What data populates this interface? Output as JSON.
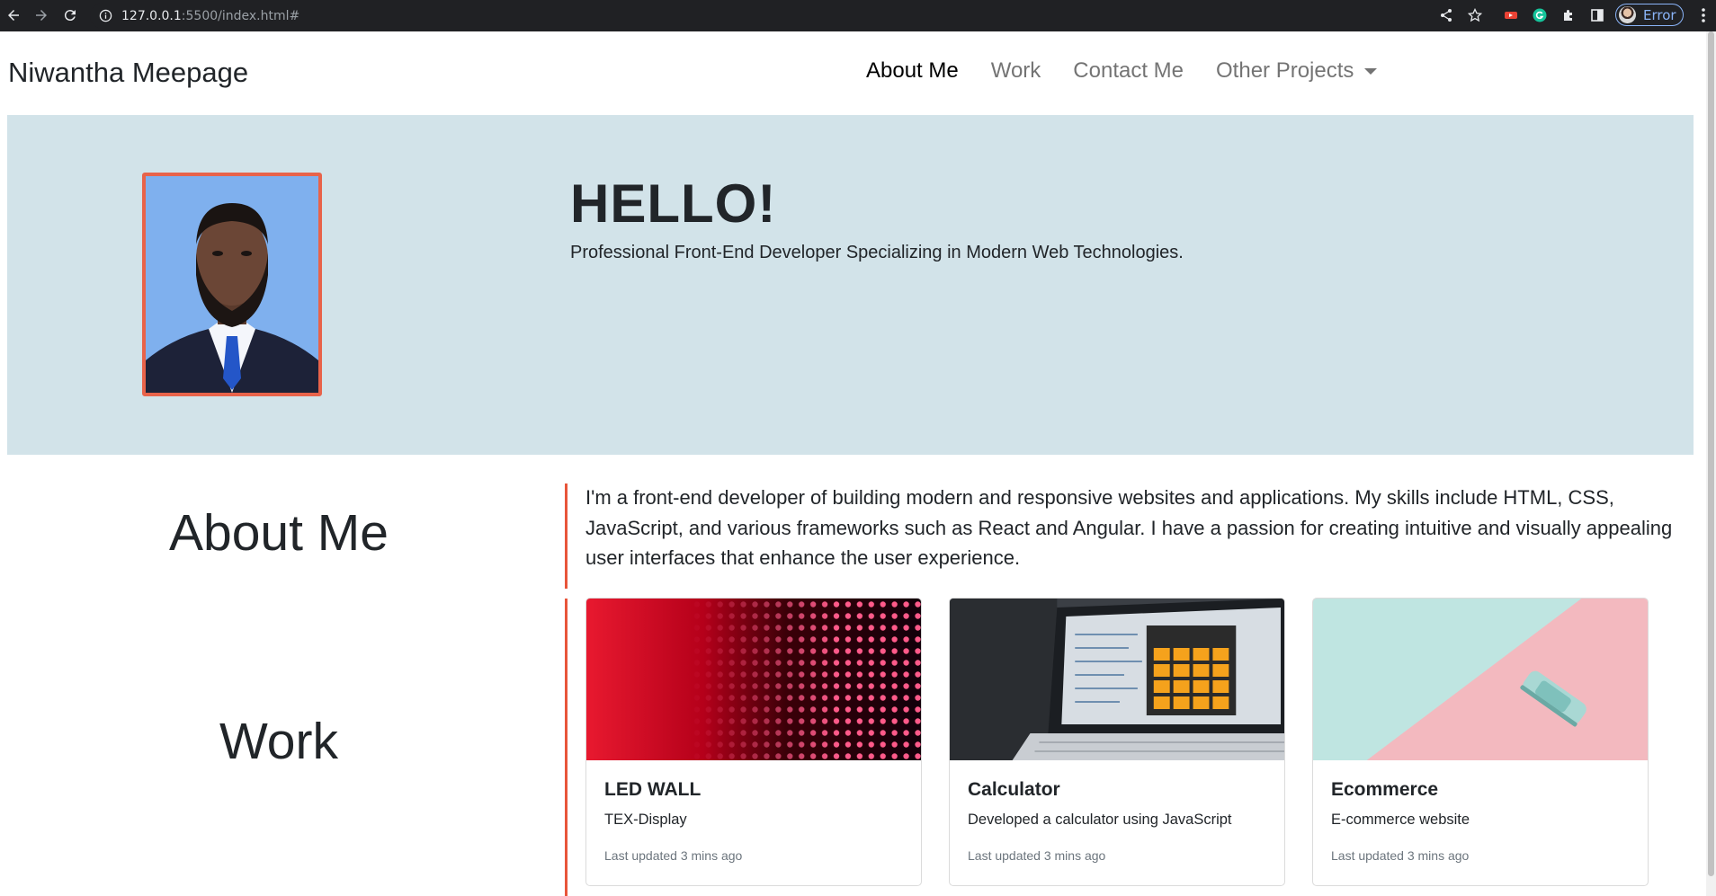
{
  "browser": {
    "url_host": "127.0.0.1",
    "url_rest": ":5500/index.html#",
    "profile_label": "Error",
    "icons": [
      "back-arrow-icon",
      "forward-arrow-icon",
      "reload-icon",
      "site-info-icon",
      "share-icon",
      "bookmark-star-icon",
      "extension-red-icon",
      "grammarly-icon",
      "puzzle-extensions-icon",
      "side-panel-icon",
      "avatar",
      "more-menu-icon"
    ]
  },
  "navbar": {
    "brand": "Niwantha Meepage",
    "links": [
      {
        "label": "About Me",
        "active": true
      },
      {
        "label": "Work",
        "active": false
      },
      {
        "label": "Contact Me",
        "active": false
      },
      {
        "label": "Other Projects",
        "active": false,
        "dropdown": true
      }
    ]
  },
  "hero": {
    "title": "HELLO!",
    "subtitle": "Professional Front-End Developer Specializing in Modern Web Technologies."
  },
  "about": {
    "heading": "About Me",
    "text": "I'm a front-end developer of building modern and responsive websites and applications. My skills include HTML, CSS, JavaScript, and various frameworks such as React and Angular. I have a passion for creating intuitive and visually appealing user interfaces that enhance the user experience."
  },
  "work": {
    "heading": "Work",
    "cards": [
      {
        "title": "LED WALL",
        "text": "TEX-Display",
        "meta": "Last updated 3 mins ago"
      },
      {
        "title": "Calculator",
        "text": "Developed a calculator using JavaScript",
        "meta": "Last updated 3 mins ago"
      },
      {
        "title": "Ecommerce",
        "text": "E-commerce website",
        "meta": "Last updated 3 mins ago"
      }
    ]
  },
  "colors": {
    "hero_bg": "#d2e3e9",
    "accent": "#e8553a",
    "chrome_bg": "#202124"
  }
}
